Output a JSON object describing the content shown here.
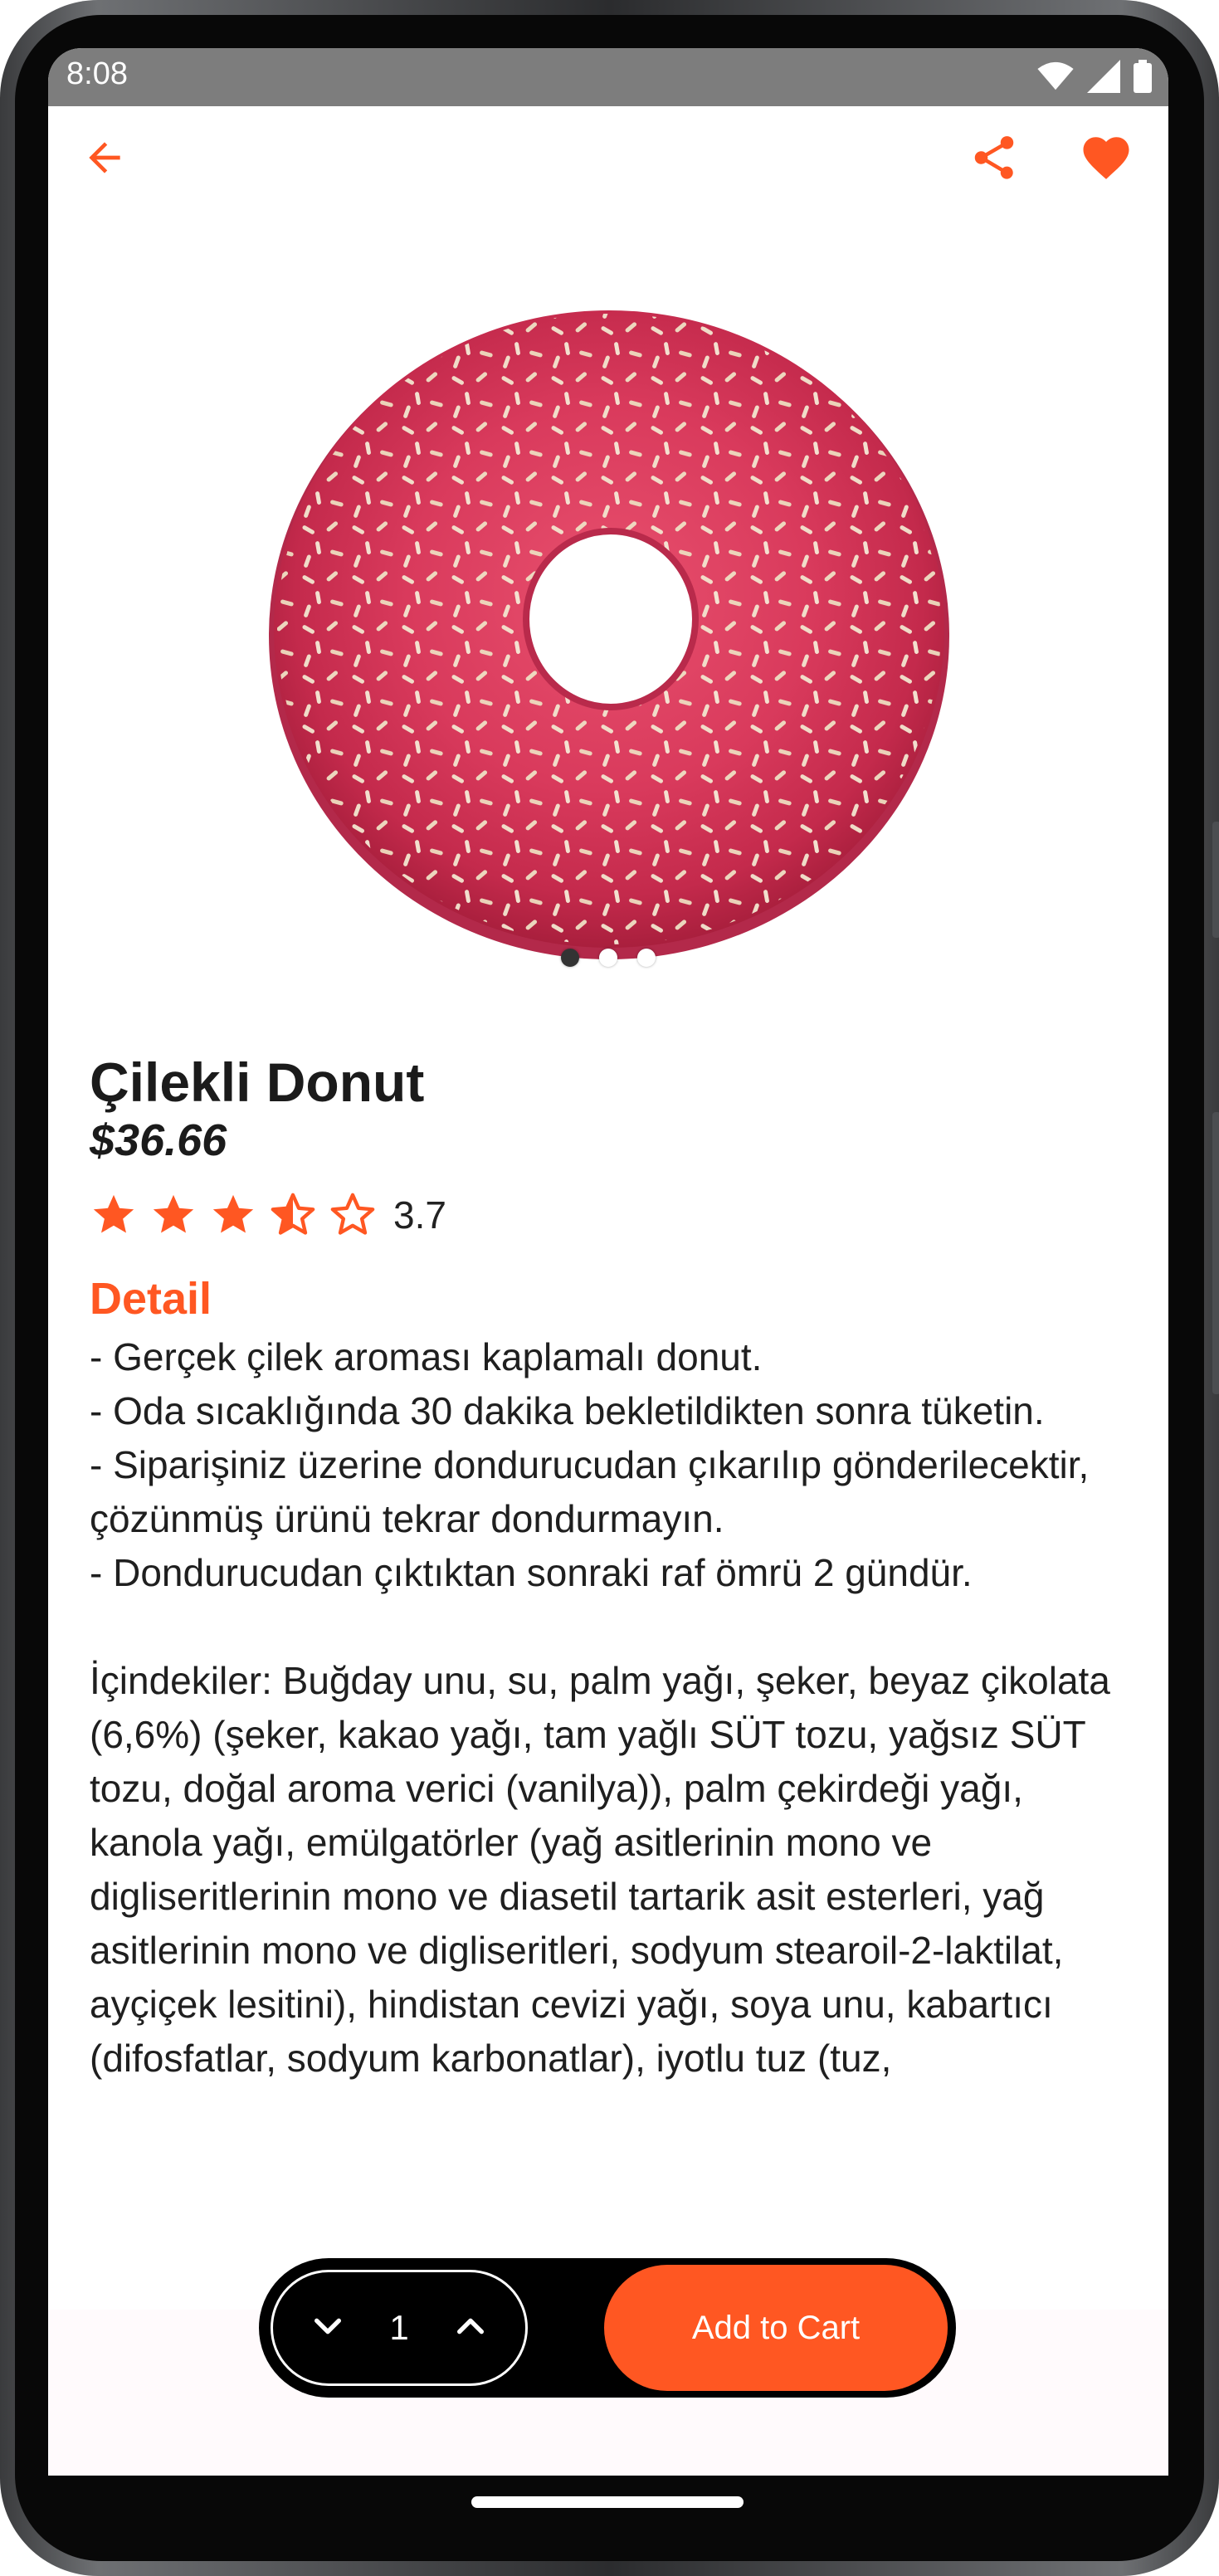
{
  "status_bar": {
    "time": "8:08"
  },
  "product": {
    "title": "Çilekli Donut",
    "price": "$36.66",
    "rating_value": "3.7",
    "rating": 3.7,
    "rating_max": 5,
    "image_alt": "strawberry-glazed-donut-with-sprinkles",
    "carousel_count": 3,
    "carousel_active": 0
  },
  "detail": {
    "heading": "Detail",
    "text": "- Gerçek çilek aroması kaplamalı donut.\n- Oda sıcaklığında 30 dakika bekletildikten sonra tüketin.\n- Siparişiniz üzerine dondurucudan çıkarılıp gönderilecektir, çözünmüş ürünü tekrar dondurmayın.\n- Dondurucudan çıktıktan sonraki raf ömrü 2 gündür.\n\nİçindekiler: Buğday unu, su, palm yağı, şeker, beyaz çikolata (6,6%) (şeker, kakao yağı, tam yağlı SÜT tozu, yağsız SÜT tozu, doğal aroma verici (vanilya)), palm çekirdeği yağı, kanola yağı, emülgatörler (yağ asitlerinin mono ve digliseritlerinin mono ve diasetil tartarik asit esterleri, yağ asitlerinin mono ve digliseritleri, sodyum stearoil-2-laktilat, ayçiçek lesitini), hindistan cevizi yağı, soya unu, kabartıcı (difosfatlar, sodyum karbonatlar), iyotlu tuz (tuz,"
  },
  "cart": {
    "quantity": "1",
    "add_label": "Add to Cart"
  },
  "colors": {
    "accent": "#ff5722",
    "text": "#1b1b1b",
    "status_bar": "#7d7d7d"
  },
  "icons": {
    "back": "arrow-back-icon",
    "share": "share-icon",
    "favorite": "heart-icon",
    "decrease": "chevron-down-icon",
    "increase": "chevron-up-icon"
  }
}
